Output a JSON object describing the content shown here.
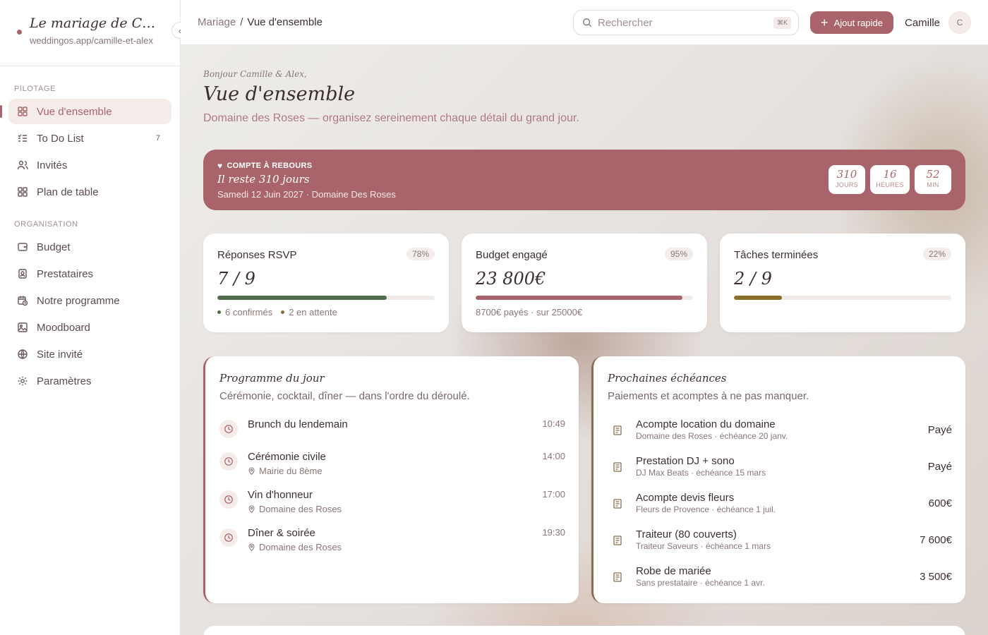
{
  "brand": {
    "title": "Le mariage de Camille & Alex",
    "url": "weddingos.app/camille-et-alex"
  },
  "sidebar": {
    "sections": [
      {
        "label": "PILOTAGE",
        "items": [
          {
            "label": "Vue d'ensemble",
            "icon": "grid-icon",
            "active": true
          },
          {
            "label": "To Do List",
            "icon": "checklist-icon",
            "badge": "7"
          },
          {
            "label": "Invités",
            "icon": "users-icon"
          },
          {
            "label": "Plan de table",
            "icon": "table-layout-icon"
          }
        ]
      },
      {
        "label": "ORGANISATION",
        "items": [
          {
            "label": "Budget",
            "icon": "wallet-icon"
          },
          {
            "label": "Prestataires",
            "icon": "contact-card-icon"
          },
          {
            "label": "Notre programme",
            "icon": "calendar-clock-icon"
          },
          {
            "label": "Moodboard",
            "icon": "image-icon"
          },
          {
            "label": "Site invité",
            "icon": "globe-icon"
          },
          {
            "label": "Paramètres",
            "icon": "gear-icon"
          }
        ]
      }
    ]
  },
  "header": {
    "breadcrumb": {
      "parent": "Mariage",
      "separator": "/",
      "current": "Vue d'ensemble"
    },
    "search": {
      "placeholder": "Rechercher",
      "shortcut": "⌘K"
    },
    "quick_add": "Ajout rapide",
    "user": {
      "name": "Camille",
      "initial": "C"
    }
  },
  "page": {
    "greeting": "Bonjour Camille & Alex,",
    "title": "Vue d'ensemble",
    "subtitle": "Domaine des Roses — organisez sereinement chaque détail du grand jour."
  },
  "countdown": {
    "label": "COMPTE À REBOURS",
    "remaining": "Il reste 310 jours",
    "date": "Samedi 12 Juin 2027 · Domaine Des Roses",
    "units": [
      {
        "value": "310",
        "label": "JOURS"
      },
      {
        "value": "16",
        "label": "HEURES"
      },
      {
        "value": "52",
        "label": "MIN"
      }
    ]
  },
  "stats": [
    {
      "title": "Réponses RSVP",
      "pct_label": "78%",
      "progress": 0.78,
      "value": "7 / 9",
      "color": "#4f6b4a",
      "foot": [
        {
          "text": "6 confirmés",
          "color": "#4f6b4a"
        },
        {
          "text": "2 en attente",
          "color": "#8a6e3a"
        }
      ]
    },
    {
      "title": "Budget engagé",
      "pct_label": "95%",
      "progress": 0.95,
      "value": "23 800€",
      "color": "#a8646a",
      "foot": [
        {
          "text": "8700€ payés · sur 25000€"
        }
      ]
    },
    {
      "title": "Tâches terminées",
      "pct_label": "22%",
      "progress": 0.22,
      "value": "2 / 9",
      "color": "#8a6e2a",
      "foot": []
    }
  ],
  "programme": {
    "title": "Programme du jour",
    "subtitle": "Cérémonie, cocktail, dîner — dans l'ordre du déroulé.",
    "items": [
      {
        "name": "Brunch du lendemain",
        "location": "",
        "time": "10:49"
      },
      {
        "name": "Cérémonie civile",
        "location": "Mairie du 8ème",
        "time": "14:00"
      },
      {
        "name": "Vin d'honneur",
        "location": "Domaine des Roses",
        "time": "17:00"
      },
      {
        "name": "Dîner & soirée",
        "location": "Domaine des Roses",
        "time": "19:30"
      }
    ]
  },
  "deadlines": {
    "title": "Prochaines échéances",
    "subtitle": "Paiements et acomptes à ne pas manquer.",
    "items": [
      {
        "name": "Acompte location du domaine",
        "meta": "Domaine des Roses · échéance 20 janv.",
        "amount": "Payé"
      },
      {
        "name": "Prestation DJ + sono",
        "meta": "DJ Max Beats · échéance 15 mars",
        "amount": "Payé"
      },
      {
        "name": "Acompte devis fleurs",
        "meta": "Fleurs de Provence · échéance 1 juil.",
        "amount": "600€"
      },
      {
        "name": "Traiteur (80 couverts)",
        "meta": "Traiteur Saveurs · échéance 1 mars",
        "amount": "7 600€"
      },
      {
        "name": "Robe de mariée",
        "meta": "Sans prestataire · échéance 1 avr.",
        "amount": "3 500€"
      }
    ]
  },
  "colors": {
    "accent": "#a8646a",
    "green": "#4f6b4a",
    "gold": "#8a6e2a"
  }
}
